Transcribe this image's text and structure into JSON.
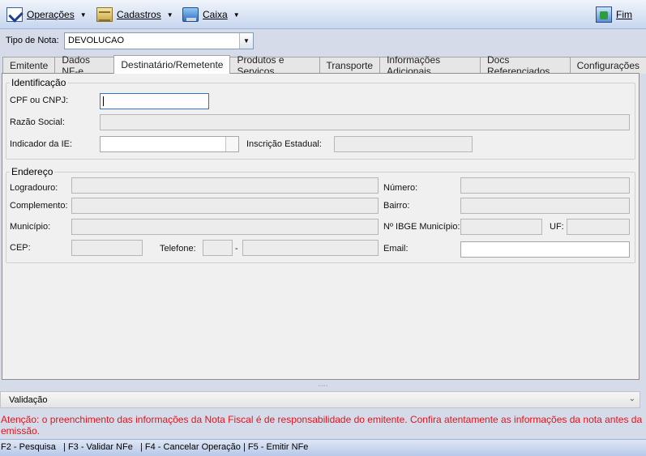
{
  "toolbar": {
    "items": [
      {
        "label": "Operações",
        "icon": "checklist-icon"
      },
      {
        "label": "Cadastros",
        "icon": "archive-icon"
      },
      {
        "label": "Caixa",
        "icon": "cash-register-icon"
      }
    ],
    "exit_label": "Fim",
    "exit_icon": "exit-door-icon"
  },
  "tipo_nota": {
    "label": "Tipo de Nota:",
    "value": "DEVOLUCAO"
  },
  "tabs": [
    {
      "label": "Emitente"
    },
    {
      "label": "Dados NF-e"
    },
    {
      "label": "Destinatário/Remetente",
      "active": true
    },
    {
      "label": "Produtos e Serviços"
    },
    {
      "label": "Transporte"
    },
    {
      "label": "Informações Adicionais"
    },
    {
      "label": "Docs Referenciados"
    },
    {
      "label": "Configurações"
    }
  ],
  "identificacao": {
    "title": "Identificação",
    "cpf_label": "CPF ou CNPJ:",
    "cpf_value": "",
    "razao_label": "Razão Social:",
    "razao_value": "",
    "indicador_label": "Indicador da IE:",
    "indicador_value": "",
    "ie_label": "Inscrição Estadual:",
    "ie_value": ""
  },
  "endereco": {
    "title": "Endereço",
    "logradouro_label": "Logradouro:",
    "numero_label": "Número:",
    "complemento_label": "Complemento:",
    "bairro_label": "Bairro:",
    "municipio_label": "Município:",
    "ibge_label": "Nº IBGE Município:",
    "uf_label": "UF:",
    "cep_label": "CEP:",
    "telefone_label": "Telefone:",
    "telefone_sep": "-",
    "email_label": "Email:"
  },
  "validacao": {
    "label": "Validação"
  },
  "warning": "Atenção: o preenchimento das informações da Nota Fiscal é de responsabilidade do emitente. Confira atentamente as informações da nota antes da emissão.",
  "status_bar": "F2 - Pesquisa   | F3 - Validar NFe   | F4 - Cancelar Operação | F5 - Emitir NFe",
  "colors": {
    "warning": "#e0141c",
    "focus_border": "#2f74c8"
  }
}
